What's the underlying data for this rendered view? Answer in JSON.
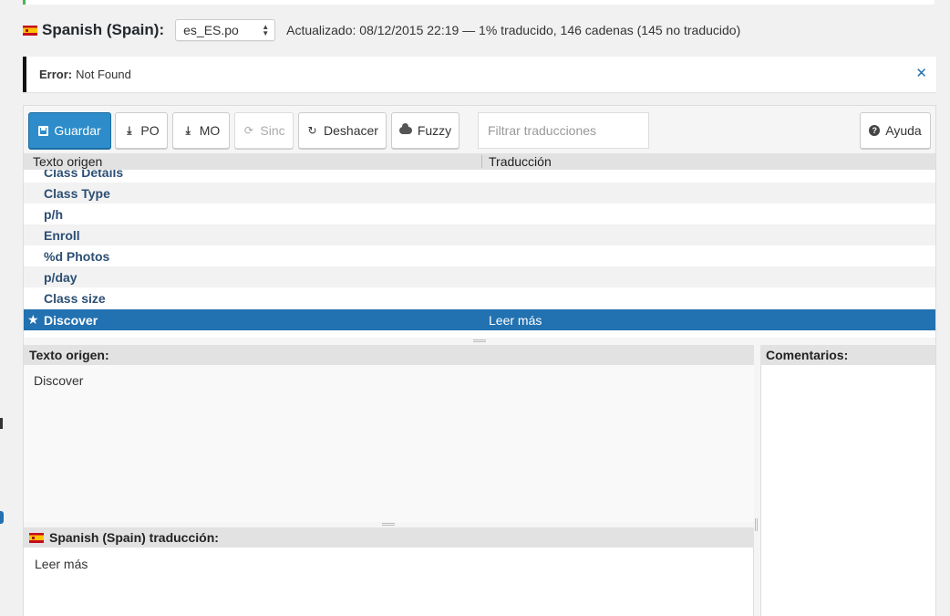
{
  "header": {
    "language_name": "Spanish (Spain):",
    "locale_value": "es_ES.po",
    "status": "Actualizado: 08/12/2015 22:19 — 1% traducido, 146 cadenas (145 no traducido)"
  },
  "notice": {
    "label": "Error:",
    "message": "Not Found",
    "close_glyph": "✕"
  },
  "toolbar": {
    "save_label": "Guardar",
    "po_label": "PO",
    "mo_label": "MO",
    "sync_label": "Sinc",
    "undo_label": "Deshacer",
    "fuzzy_label": "Fuzzy",
    "filter_placeholder": "Filtrar traducciones",
    "help_label": "Ayuda"
  },
  "list": {
    "col_source": "Texto origen",
    "col_translation": "Traducción",
    "rows": [
      {
        "source": "Class Details",
        "translation": ""
      },
      {
        "source": "Class Type",
        "translation": ""
      },
      {
        "source": "p/h",
        "translation": ""
      },
      {
        "source": "Enroll",
        "translation": ""
      },
      {
        "source": "%d Photos",
        "translation": ""
      },
      {
        "source": "p/day",
        "translation": ""
      },
      {
        "source": "Class size",
        "translation": ""
      },
      {
        "source": "Discover",
        "translation": "Leer más"
      }
    ]
  },
  "source_pane": {
    "heading": "Texto origen:",
    "text": "Discover"
  },
  "translation_pane": {
    "heading": "Spanish (Spain) traducción:",
    "text": "Leer más"
  },
  "comments_pane": {
    "heading": "Comentarios:"
  },
  "colors": {
    "primary": "#2d8cc9",
    "selected_row": "#2271b1",
    "link_text": "#2c4f73"
  }
}
